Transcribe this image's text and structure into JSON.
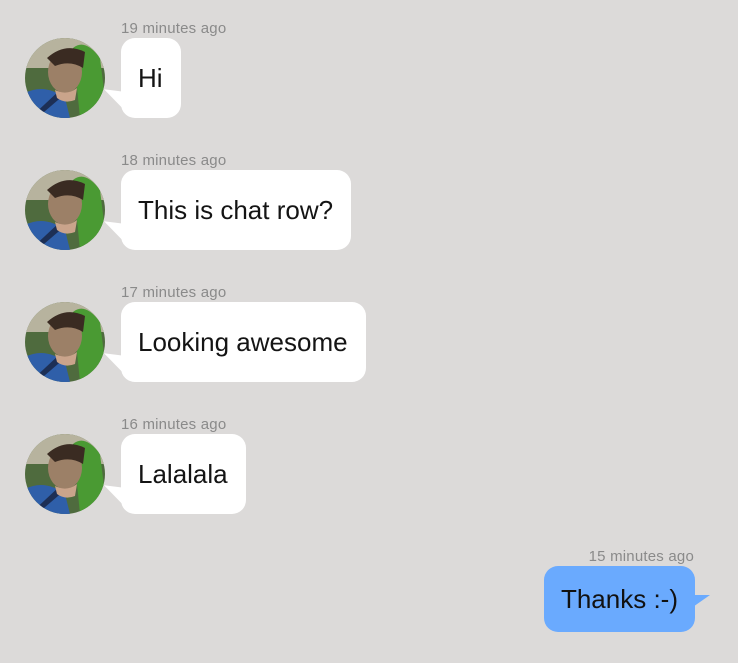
{
  "messages": [
    {
      "time": "19 minutes ago",
      "text": "Hi",
      "direction": "incoming"
    },
    {
      "time": "18 minutes ago",
      "text": "This is chat row?",
      "direction": "incoming"
    },
    {
      "time": "17 minutes ago",
      "text": "Looking awesome",
      "direction": "incoming"
    },
    {
      "time": "16 minutes ago",
      "text": "Lalalala",
      "direction": "incoming"
    },
    {
      "time": "15 minutes ago",
      "text": "Thanks :-)",
      "direction": "outgoing"
    }
  ],
  "colors": {
    "background": "#dcdad9",
    "incoming_bubble": "#ffffff",
    "outgoing_bubble": "#6aaafe",
    "timestamp": "#8a8a8a"
  }
}
